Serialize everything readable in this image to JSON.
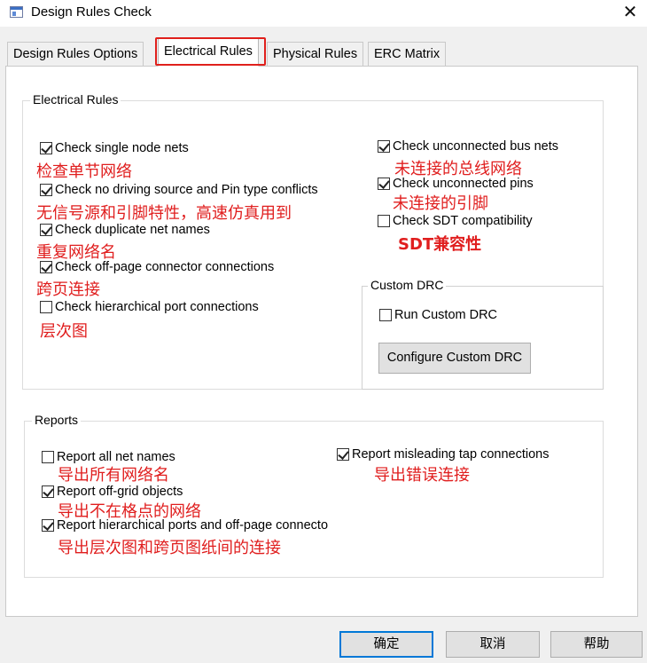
{
  "window": {
    "title": "Design Rules Check",
    "close_glyph": "✕",
    "icon": "app-window-icon"
  },
  "tabs": [
    {
      "label": "Design Rules Options"
    },
    {
      "label": "Electrical Rules"
    },
    {
      "label": "Physical Rules"
    },
    {
      "label": "ERC Matrix"
    }
  ],
  "electrical_group": {
    "legend": "Electrical Rules",
    "left_items": [
      {
        "label": "Check single node nets",
        "checked": true,
        "note": "检查单节网络"
      },
      {
        "label": "Check no driving source and Pin type conflicts",
        "checked": true,
        "note": "无信号源和引脚特性，高速仿真用到"
      },
      {
        "label": "Check duplicate net names",
        "checked": true,
        "note": "重复网络名"
      },
      {
        "label": "Check off-page connector connections",
        "checked": true,
        "note": "跨页连接"
      },
      {
        "label": "Check hierarchical port connections",
        "checked": false,
        "note": "层次图"
      }
    ],
    "right_items": [
      {
        "label": "Check unconnected bus nets",
        "checked": true,
        "note": "未连接的总线网络"
      },
      {
        "label": "Check unconnected pins",
        "checked": true,
        "note": "未连接的引脚"
      },
      {
        "label": "Check SDT compatibility",
        "checked": false,
        "note": "SDT兼容性"
      }
    ]
  },
  "custom_drc": {
    "legend": "Custom DRC",
    "run_label": "Run Custom DRC",
    "run_checked": false,
    "configure_label": "Configure Custom DRC"
  },
  "reports_group": {
    "legend": "Reports",
    "items": [
      {
        "label": "Report all net names",
        "checked": false,
        "note": "导出所有网络名"
      },
      {
        "label": "Report off-grid objects",
        "checked": true,
        "note": "导出不在格点的网络"
      },
      {
        "label": "Report hierarchical ports and off-page connecto",
        "checked": true,
        "note": "导出层次图和跨页图纸间的连接"
      },
      {
        "label": "Report misleading tap connections",
        "checked": true,
        "note": "导出错误连接"
      }
    ]
  },
  "buttons": {
    "ok": "确定",
    "cancel": "取消",
    "help": "帮助"
  },
  "colors": {
    "annotation_red": "#e01e1e",
    "highlight_red": "#e0201c",
    "focus_blue": "#0078d7"
  }
}
